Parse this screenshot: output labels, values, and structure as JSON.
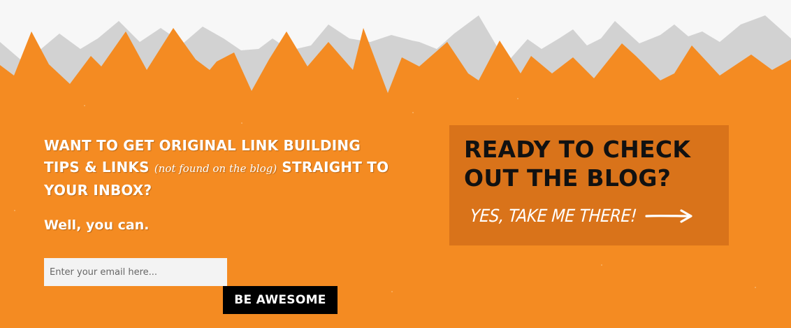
{
  "colors": {
    "background": "#f7f7f7",
    "mountain_gray": "#d2d2d2",
    "orange": "#f48b22",
    "cta_box": "#d9731a",
    "button_bg": "#000000"
  },
  "newsletter": {
    "headline_part1": "WANT TO GET ORIGINAL LINK BUILDING TIPS & LINKS ",
    "headline_aside": "(not found on the blog)",
    "headline_part2": " STRAIGHT TO YOUR INBOX?",
    "subline": "Well, you can.",
    "email_placeholder": "Enter your email here...",
    "email_value": "",
    "submit_label": "BE AWESOME"
  },
  "blog_cta": {
    "title": "READY TO CHECK OUT THE BLOG?",
    "link_label": "YES, TAKE ME THERE!",
    "arrow_icon": "right-arrow-icon"
  }
}
